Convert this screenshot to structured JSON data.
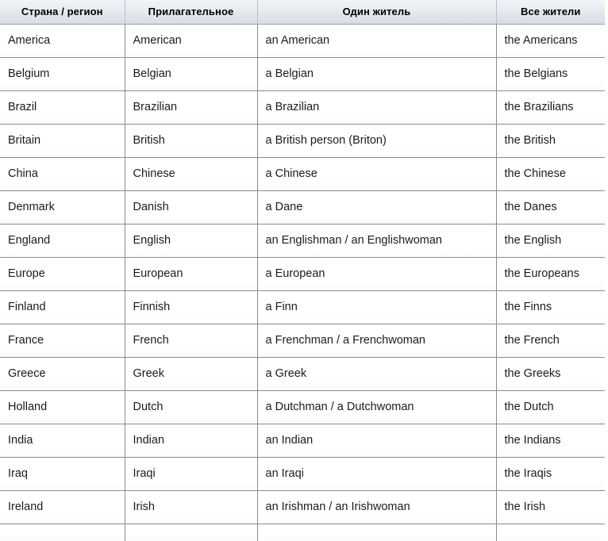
{
  "table": {
    "headers": [
      "Страна / регион",
      "Прилагательное",
      "Один житель",
      "Все жители"
    ],
    "rows": [
      [
        "America",
        "American",
        "an American",
        "the Americans"
      ],
      [
        "Belgium",
        "Belgian",
        "a Belgian",
        "the Belgians"
      ],
      [
        "Brazil",
        "Brazilian",
        "a Brazilian",
        "the Brazilians"
      ],
      [
        "Britain",
        "British",
        "a British person (Briton)",
        "the British"
      ],
      [
        "China",
        "Chinese",
        "a Chinese",
        "the Chinese"
      ],
      [
        "Denmark",
        "Danish",
        "a Dane",
        "the Danes"
      ],
      [
        "England",
        "English",
        "an Englishman / an Englishwoman",
        "the English"
      ],
      [
        "Europe",
        "European",
        "a European",
        "the Europeans"
      ],
      [
        "Finland",
        "Finnish",
        "a Finn",
        "the Finns"
      ],
      [
        "France",
        "French",
        "a Frenchman / a Frenchwoman",
        "the French"
      ],
      [
        "Greece",
        "Greek",
        "a Greek",
        "the Greeks"
      ],
      [
        "Holland",
        "Dutch",
        "a Dutchman / a Dutchwoman",
        "the Dutch"
      ],
      [
        "India",
        "Indian",
        "an Indian",
        "the Indians"
      ],
      [
        "Iraq",
        "Iraqi",
        "an Iraqi",
        "the Iraqis"
      ],
      [
        "Ireland",
        "Irish",
        "an Irishman / an Irishwoman",
        "the Irish"
      ],
      [
        "",
        "",
        "",
        ""
      ]
    ]
  },
  "colors": {
    "header_top": "#f2f4f7",
    "header_bottom": "#d8dde5",
    "grid_line": "#8c8c8c",
    "text": "#1b1b1b",
    "page_background": "#ffffff"
  }
}
